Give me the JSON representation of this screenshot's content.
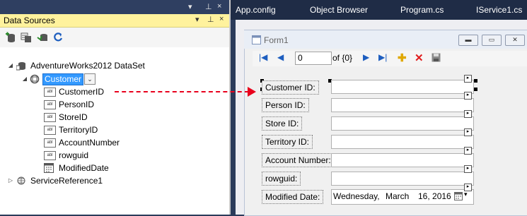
{
  "top_strip": {
    "pin_down": "▾",
    "pin": "⊥",
    "close": "×"
  },
  "data_sources": {
    "title": "Data Sources",
    "header_buttons": [
      "▾",
      "⊥",
      "×"
    ],
    "toolbar_icons": [
      "add-data-source-icon",
      "edit-dataset-designer-icon",
      "configure-dataset-icon",
      "refresh-icon"
    ],
    "tree": {
      "dataset": "AdventureWorks2012 DataSet",
      "table": "Customer",
      "fields": [
        {
          "name": "CustomerID",
          "type": "abl"
        },
        {
          "name": "PersonID",
          "type": "abl"
        },
        {
          "name": "StoreID",
          "type": "abl"
        },
        {
          "name": "TerritoryID",
          "type": "abl"
        },
        {
          "name": "AccountNumber",
          "type": "abl"
        },
        {
          "name": "rowguid",
          "type": "abl"
        },
        {
          "name": "ModifiedDate",
          "type": "date"
        }
      ],
      "service": "ServiceReference1"
    }
  },
  "tabs": [
    "App.config",
    "Object Browser",
    "Program.cs",
    "IService1.cs"
  ],
  "form": {
    "title": "Form1",
    "navigator": {
      "position": "0",
      "count": "of {0}"
    },
    "fields": [
      {
        "label": "Customer ID:",
        "value": ""
      },
      {
        "label": "Person ID:",
        "value": ""
      },
      {
        "label": "Store ID:",
        "value": ""
      },
      {
        "label": "Territory ID:",
        "value": ""
      },
      {
        "label": "Account Number:",
        "value": ""
      },
      {
        "label": "rowguid:",
        "value": ""
      }
    ],
    "date_field": {
      "label": "Modified Date:",
      "weekday": "Wednesday,",
      "month": "March",
      "day": "16, 2016"
    }
  },
  "colors": {
    "accent": "#3399ff",
    "arrow": "#e8001c",
    "header": "#fff29d",
    "tab_bar": "#1f2c46"
  }
}
